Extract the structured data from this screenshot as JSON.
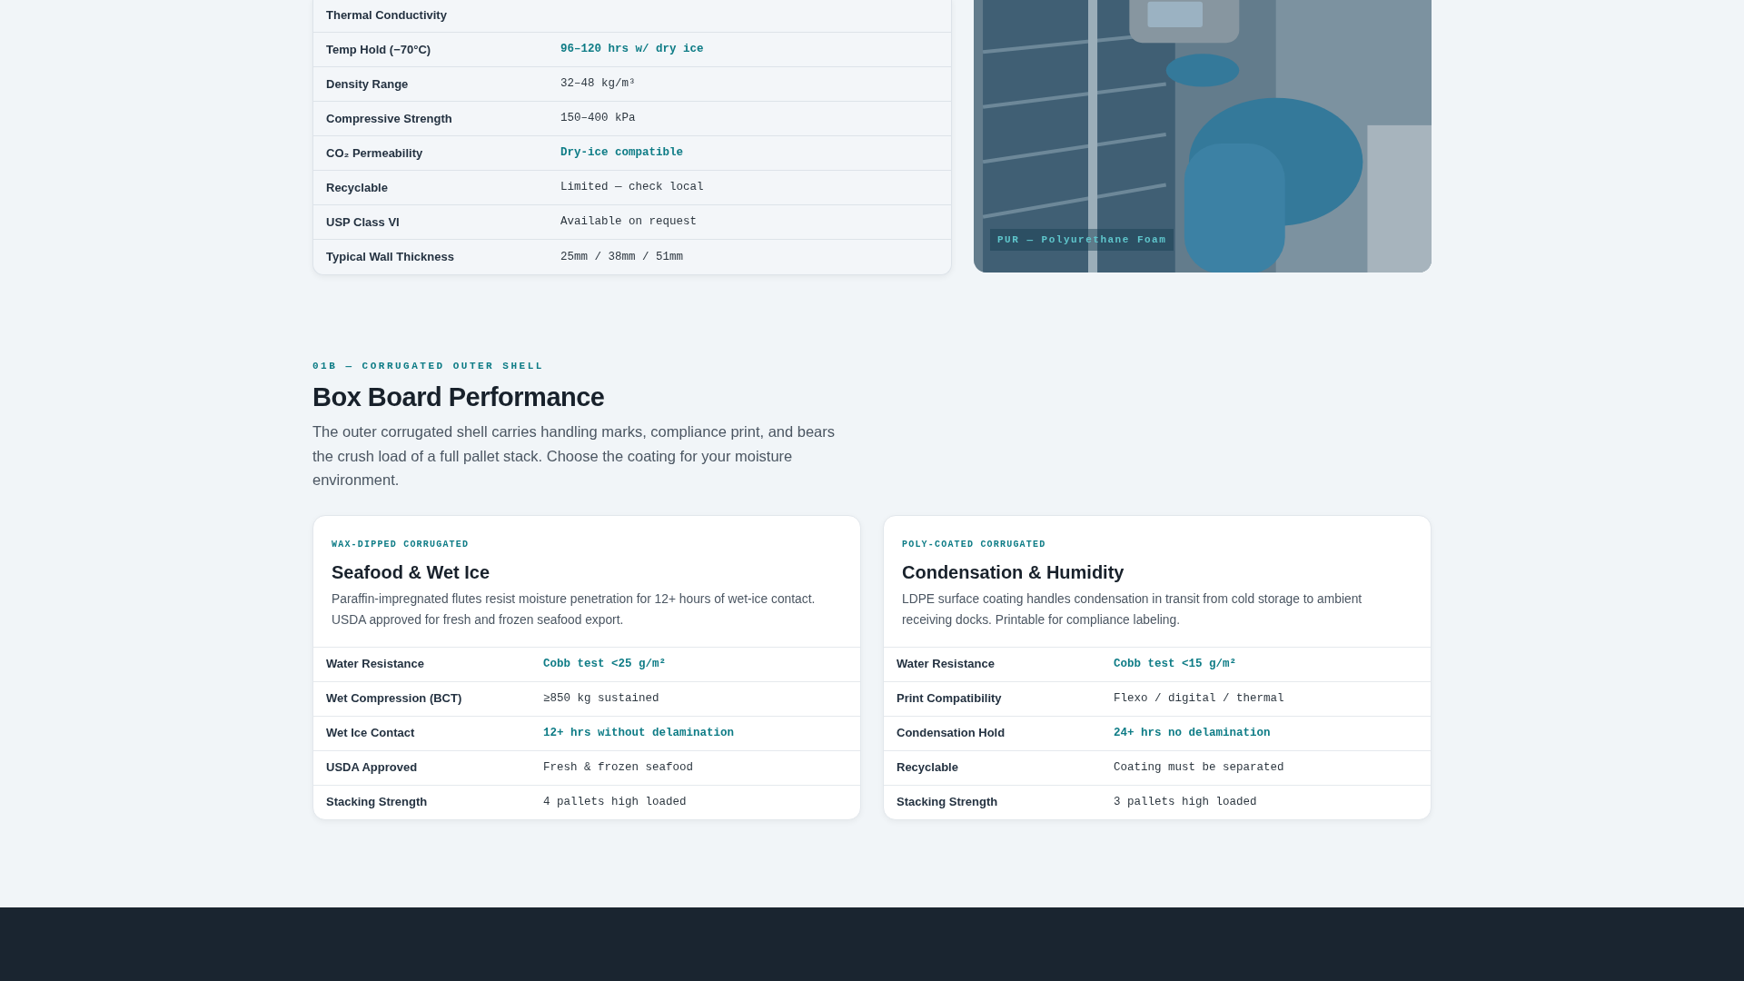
{
  "foam_table": {
    "rows": [
      {
        "label": "Thermal Conductivity",
        "highlight": false
      },
      {
        "label": "Temp Hold (−70°C)",
        "value": "96–120 hrs w/ dry ice",
        "highlight": true
      },
      {
        "label": "Density Range",
        "value": "32–48 kg/m³",
        "highlight": false
      },
      {
        "label": "Compressive Strength",
        "value": "150–400 kPa",
        "highlight": false
      },
      {
        "label": "CO₂ Permeability",
        "value": "Dry-ice compatible",
        "highlight": true
      },
      {
        "label": "Recyclable",
        "value": "Limited — check local",
        "highlight": false
      },
      {
        "label": "USP Class VI",
        "value": "Available on request",
        "highlight": false
      },
      {
        "label": "Typical Wall Thickness",
        "value": "25mm / 38mm / 51mm",
        "highlight": false
      }
    ]
  },
  "photo": {
    "kind": "picture",
    "caption": "PUR — Polyurethane Foam"
  },
  "section": {
    "eyebrow": "01B — CORRUGATED OUTER SHELL",
    "title": "Box Board Performance",
    "intro": "The outer corrugated shell carries handling marks, compliance print, and bears the crush load of a full pallet stack. Choose the coating for your moisture environment."
  },
  "cards": [
    {
      "eyebrow": "WAX-DIPPED CORRUGATED",
      "title": "Seafood & Wet Ice",
      "description": "Paraffin-impregnated flutes resist moisture penetration for 12+ hours of wet-ice contact. USDA approved for fresh and frozen seafood export.",
      "rows": [
        {
          "label": "Water Resistance",
          "value": "Cobb test <25 g/m²",
          "highlight": true
        },
        {
          "label": "Wet Compression (BCT)",
          "value": "≥850 kg sustained",
          "highlight": false
        },
        {
          "label": "Wet Ice Contact",
          "value": "12+ hrs without delamination",
          "highlight": true
        },
        {
          "label": "USDA Approved",
          "value": "Fresh & frozen seafood",
          "highlight": false
        },
        {
          "label": "Stacking Strength",
          "value": "4 pallets high loaded",
          "highlight": false
        }
      ]
    },
    {
      "eyebrow": "POLY-COATED CORRUGATED",
      "title": "Condensation & Humidity",
      "description": "LDPE surface coating handles condensation in transit from cold storage to ambient receiving docks. Printable for compliance labeling.",
      "rows": [
        {
          "label": "Water Resistance",
          "value": "Cobb test <15 g/m²",
          "highlight": true
        },
        {
          "label": "Print Compatibility",
          "value": "Flexo / digital / thermal",
          "highlight": false
        },
        {
          "label": "Condensation Hold",
          "value": "24+ hrs no delamination",
          "highlight": true
        },
        {
          "label": "Recyclable",
          "value": "Coating must be separated",
          "highlight": false
        },
        {
          "label": "Stacking Strength",
          "value": "3 pallets high loaded",
          "highlight": false
        }
      ]
    }
  ]
}
